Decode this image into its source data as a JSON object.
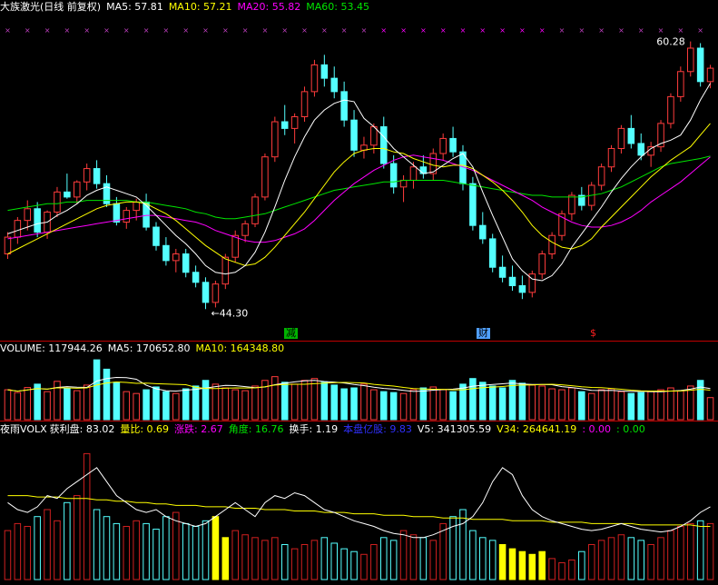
{
  "header_main": {
    "title": "大族激光(日线 前复权)",
    "ma5": "MA5: 57.81",
    "ma10": "MA10: 57.21",
    "ma20": "MA20: 55.82",
    "ma60": "MA60: 53.45"
  },
  "header_volume": {
    "volume": "VOLUME: 117944.26",
    "ma5": "MA5: 170652.80",
    "ma10": "MA10: 164348.80"
  },
  "header_indicator": {
    "name": "夜雨VOLX",
    "profit": "获利盘: 83.02",
    "ratio": "量比: 0.69",
    "change": "涨跌: 2.67",
    "angle": "角度: 16.76",
    "turnover": "换手: 1.19",
    "float": "本盘亿股: 9.83",
    "v5": "V5: 341305.59",
    "v34": "V34: 264641.19",
    "e1": ": 0.00",
    "e2": ": 0.00"
  },
  "markers": {
    "m1": "减",
    "m2": "财",
    "m3": "$"
  },
  "colors": {
    "up": "#ff3c3c",
    "down": "#54ffff",
    "ma5": "#ffffff",
    "ma10": "#ffff00",
    "ma20": "#ff00ff",
    "ma60": "#00e600",
    "volred": "#d02020",
    "highlight": "#ffff00",
    "separator": "#c00000"
  },
  "chart_data": {
    "type": "candlestick",
    "price_range": [
      43.5,
      61.8
    ],
    "high_label": "60.28",
    "low_label": "44.30",
    "ohlc": [
      [
        47.6,
        48.9,
        47.3,
        48.6
      ],
      [
        48.6,
        49.8,
        48.2,
        49.6
      ],
      [
        49.6,
        50.8,
        49.0,
        50.3
      ],
      [
        50.3,
        50.7,
        48.6,
        48.9
      ],
      [
        48.9,
        50.2,
        48.5,
        50.1
      ],
      [
        50.1,
        51.6,
        49.8,
        51.3
      ],
      [
        51.3,
        52.4,
        50.9,
        51.0
      ],
      [
        51.0,
        52.0,
        50.6,
        51.9
      ],
      [
        51.9,
        53.0,
        51.4,
        52.7
      ],
      [
        52.7,
        53.2,
        51.5,
        51.8
      ],
      [
        51.8,
        52.3,
        50.4,
        50.6
      ],
      [
        50.6,
        51.0,
        49.3,
        49.5
      ],
      [
        49.5,
        50.4,
        49.1,
        50.2
      ],
      [
        50.2,
        50.9,
        49.6,
        50.7
      ],
      [
        50.7,
        51.2,
        49.0,
        49.2
      ],
      [
        49.2,
        49.5,
        47.8,
        48.1
      ],
      [
        48.1,
        48.6,
        46.9,
        47.2
      ],
      [
        47.2,
        47.9,
        46.5,
        47.6
      ],
      [
        47.6,
        47.9,
        46.2,
        46.5
      ],
      [
        46.5,
        46.9,
        45.6,
        45.9
      ],
      [
        45.9,
        46.2,
        44.3,
        44.7
      ],
      [
        44.7,
        46.0,
        44.4,
        45.8
      ],
      [
        45.8,
        47.6,
        45.5,
        47.4
      ],
      [
        47.4,
        49.0,
        47.1,
        48.7
      ],
      [
        48.7,
        49.6,
        48.3,
        49.4
      ],
      [
        49.4,
        51.2,
        49.2,
        51.0
      ],
      [
        51.0,
        53.6,
        50.8,
        53.4
      ],
      [
        53.4,
        55.8,
        53.1,
        55.5
      ],
      [
        55.5,
        56.5,
        54.7,
        55.1
      ],
      [
        55.1,
        56.0,
        54.2,
        55.8
      ],
      [
        55.8,
        57.6,
        55.5,
        57.3
      ],
      [
        57.3,
        59.2,
        57.0,
        58.9
      ],
      [
        58.9,
        59.5,
        57.6,
        58.1
      ],
      [
        58.1,
        58.8,
        56.9,
        57.3
      ],
      [
        57.3,
        57.9,
        55.2,
        55.6
      ],
      [
        55.6,
        56.2,
        53.4,
        53.8
      ],
      [
        53.8,
        54.6,
        53.3,
        54.1
      ],
      [
        54.1,
        55.4,
        53.6,
        55.2
      ],
      [
        55.2,
        55.8,
        52.7,
        53.0
      ],
      [
        53.0,
        53.5,
        51.2,
        51.6
      ],
      [
        51.6,
        52.3,
        50.7,
        52.0
      ],
      [
        52.0,
        53.1,
        51.5,
        52.8
      ],
      [
        52.8,
        53.5,
        52.1,
        52.4
      ],
      [
        52.4,
        53.9,
        52.0,
        53.6
      ],
      [
        53.6,
        54.8,
        53.2,
        54.5
      ],
      [
        54.5,
        55.2,
        53.4,
        53.7
      ],
      [
        53.7,
        54.1,
        51.4,
        51.8
      ],
      [
        51.8,
        52.2,
        49.0,
        49.3
      ],
      [
        49.3,
        50.1,
        48.2,
        48.5
      ],
      [
        48.5,
        48.8,
        46.5,
        46.8
      ],
      [
        46.8,
        47.5,
        45.9,
        46.2
      ],
      [
        46.2,
        46.9,
        45.4,
        45.7
      ],
      [
        45.7,
        46.3,
        44.9,
        45.3
      ],
      [
        45.3,
        46.6,
        45.0,
        46.4
      ],
      [
        46.4,
        47.8,
        46.1,
        47.6
      ],
      [
        47.6,
        48.9,
        47.3,
        48.7
      ],
      [
        48.7,
        50.2,
        48.4,
        50.0
      ],
      [
        50.0,
        51.3,
        49.6,
        51.1
      ],
      [
        51.1,
        51.6,
        50.2,
        50.5
      ],
      [
        50.5,
        51.9,
        50.2,
        51.7
      ],
      [
        51.7,
        53.0,
        51.4,
        52.8
      ],
      [
        52.8,
        54.1,
        52.5,
        53.9
      ],
      [
        53.9,
        55.3,
        53.6,
        55.1
      ],
      [
        55.1,
        55.9,
        53.9,
        54.2
      ],
      [
        54.2,
        54.8,
        53.2,
        53.5
      ],
      [
        53.5,
        54.3,
        52.8,
        54.0
      ],
      [
        54.0,
        55.6,
        53.7,
        55.4
      ],
      [
        55.4,
        57.2,
        55.1,
        57.0
      ],
      [
        57.0,
        58.8,
        56.7,
        58.5
      ],
      [
        58.5,
        60.3,
        58.2,
        59.9
      ],
      [
        59.9,
        60.2,
        57.6,
        57.9
      ],
      [
        57.9,
        58.9,
        57.5,
        58.7
      ]
    ],
    "ma5": [
      48.8,
      49.0,
      49.2,
      49.4,
      49.5,
      49.9,
      50.2,
      50.6,
      51.1,
      51.4,
      51.6,
      51.4,
      51.2,
      51.0,
      50.5,
      49.9,
      49.3,
      48.7,
      48.2,
      47.6,
      46.9,
      46.5,
      46.4,
      46.5,
      46.9,
      47.7,
      48.9,
      50.4,
      52.0,
      53.4,
      54.6,
      55.6,
      56.2,
      56.6,
      56.8,
      56.7,
      55.7,
      55.2,
      54.6,
      53.9,
      53.4,
      52.9,
      52.4,
      52.5,
      52.9,
      53.3,
      53.6,
      52.8,
      51.3,
      49.9,
      48.6,
      47.3,
      46.6,
      46.1,
      46.0,
      46.3,
      47.0,
      48.0,
      48.8,
      49.6,
      50.4,
      51.3,
      52.1,
      52.8,
      53.4,
      53.9,
      54.2,
      54.4,
      54.7,
      55.6,
      56.8,
      57.8
    ],
    "ma10": [
      47.6,
      47.9,
      48.2,
      48.5,
      48.8,
      49.1,
      49.4,
      49.7,
      50.0,
      50.3,
      50.5,
      50.6,
      50.7,
      50.7,
      50.6,
      50.3,
      50.0,
      49.6,
      49.1,
      48.6,
      48.1,
      47.7,
      47.3,
      47.1,
      46.9,
      47.0,
      47.4,
      48.0,
      48.7,
      49.4,
      50.1,
      50.9,
      51.7,
      52.5,
      53.1,
      53.6,
      53.8,
      53.9,
      53.9,
      53.7,
      53.6,
      53.3,
      53.1,
      52.9,
      52.8,
      52.9,
      52.9,
      52.7,
      52.3,
      51.9,
      51.4,
      50.8,
      50.1,
      49.3,
      48.7,
      48.3,
      48.0,
      47.9,
      48.1,
      48.5,
      49.2,
      49.8,
      50.4,
      51.0,
      51.6,
      52.2,
      52.7,
      53.2,
      53.6,
      54.0,
      54.7,
      55.4
    ],
    "ma20": [
      48.5,
      48.6,
      48.7,
      48.8,
      48.9,
      49.0,
      49.1,
      49.2,
      49.3,
      49.4,
      49.5,
      49.6,
      49.7,
      49.8,
      49.9,
      49.9,
      49.8,
      49.7,
      49.6,
      49.5,
      49.3,
      49.0,
      48.8,
      48.6,
      48.4,
      48.3,
      48.3,
      48.4,
      48.6,
      48.8,
      49.1,
      49.6,
      50.2,
      50.8,
      51.3,
      51.8,
      52.2,
      52.6,
      52.9,
      53.2,
      53.4,
      53.5,
      53.4,
      53.3,
      53.2,
      53.0,
      52.8,
      52.6,
      52.3,
      52.0,
      51.7,
      51.4,
      51.1,
      50.8,
      50.4,
      50.1,
      49.8,
      49.5,
      49.3,
      49.2,
      49.2,
      49.3,
      49.5,
      49.8,
      50.2,
      50.7,
      51.1,
      51.5,
      51.9,
      52.4,
      52.9,
      53.4
    ],
    "ma60": [
      50.2,
      50.3,
      50.4,
      50.5,
      50.6,
      50.6,
      50.7,
      50.7,
      50.8,
      50.8,
      50.8,
      50.8,
      50.8,
      50.7,
      50.7,
      50.6,
      50.5,
      50.4,
      50.3,
      50.1,
      50.0,
      49.8,
      49.7,
      49.7,
      49.8,
      49.9,
      50.0,
      50.2,
      50.4,
      50.6,
      50.8,
      51.0,
      51.2,
      51.4,
      51.5,
      51.6,
      51.7,
      51.8,
      51.9,
      51.9,
      52.0,
      52.0,
      52.0,
      52.0,
      52.0,
      51.9,
      51.8,
      51.7,
      51.6,
      51.5,
      51.4,
      51.3,
      51.2,
      51.1,
      51.1,
      51.0,
      51.0,
      51.0,
      51.0,
      51.1,
      51.2,
      51.4,
      51.6,
      51.9,
      52.2,
      52.5,
      52.8,
      53.0,
      53.1,
      53.2,
      53.3,
      53.45
    ],
    "volume": [
      160000,
      145000,
      172000,
      190000,
      150000,
      205000,
      168000,
      155000,
      185000,
      320000,
      270000,
      200000,
      150000,
      140000,
      160000,
      175000,
      150000,
      140000,
      165000,
      180000,
      210000,
      190000,
      170000,
      160000,
      155000,
      180000,
      210000,
      230000,
      200000,
      190000,
      210000,
      220000,
      200000,
      185000,
      165000,
      170000,
      190000,
      160000,
      150000,
      145000,
      140000,
      160000,
      170000,
      175000,
      160000,
      150000,
      190000,
      220000,
      200000,
      180000,
      170000,
      210000,
      195000,
      185000,
      180000,
      165000,
      160000,
      170000,
      150000,
      140000,
      160000,
      165000,
      150000,
      140000,
      145000,
      150000,
      160000,
      170000,
      155000,
      180000,
      210000,
      117944
    ],
    "volume_range": [
      0,
      340000
    ],
    "volx_v5": [
      0.55,
      0.5,
      0.48,
      0.52,
      0.6,
      0.58,
      0.65,
      0.7,
      0.75,
      0.8,
      0.7,
      0.6,
      0.55,
      0.5,
      0.48,
      0.5,
      0.45,
      0.42,
      0.4,
      0.38,
      0.4,
      0.45,
      0.5,
      0.55,
      0.5,
      0.45,
      0.55,
      0.6,
      0.58,
      0.62,
      0.6,
      0.55,
      0.5,
      0.48,
      0.45,
      0.42,
      0.4,
      0.38,
      0.35,
      0.33,
      0.32,
      0.3,
      0.3,
      0.32,
      0.35,
      0.38,
      0.4,
      0.45,
      0.55,
      0.7,
      0.8,
      0.75,
      0.6,
      0.5,
      0.45,
      0.42,
      0.4,
      0.38,
      0.36,
      0.35,
      0.36,
      0.38,
      0.4,
      0.38,
      0.36,
      0.35,
      0.34,
      0.35,
      0.38,
      0.42,
      0.48,
      0.52
    ],
    "volx_v34": [
      0.6,
      0.6,
      0.6,
      0.59,
      0.59,
      0.59,
      0.58,
      0.58,
      0.58,
      0.57,
      0.57,
      0.56,
      0.56,
      0.55,
      0.55,
      0.54,
      0.54,
      0.53,
      0.53,
      0.53,
      0.52,
      0.52,
      0.52,
      0.51,
      0.51,
      0.51,
      0.5,
      0.5,
      0.5,
      0.49,
      0.49,
      0.49,
      0.48,
      0.48,
      0.48,
      0.47,
      0.47,
      0.47,
      0.46,
      0.46,
      0.46,
      0.45,
      0.45,
      0.45,
      0.44,
      0.44,
      0.44,
      0.43,
      0.43,
      0.43,
      0.43,
      0.42,
      0.42,
      0.42,
      0.42,
      0.41,
      0.41,
      0.41,
      0.41,
      0.4,
      0.4,
      0.4,
      0.4,
      0.4,
      0.39,
      0.39,
      0.39,
      0.39,
      0.39,
      0.39,
      0.38,
      0.38
    ],
    "volx_bars": [
      0.35,
      0.4,
      0.38,
      0.45,
      0.5,
      0.42,
      0.55,
      0.6,
      0.9,
      0.5,
      0.45,
      0.4,
      0.38,
      0.42,
      0.4,
      0.36,
      0.45,
      0.48,
      0.4,
      0.38,
      0.42,
      0.45,
      0.3,
      0.35,
      0.32,
      0.3,
      0.28,
      0.3,
      0.25,
      0.22,
      0.25,
      0.28,
      0.3,
      0.26,
      0.22,
      0.2,
      0.18,
      0.25,
      0.3,
      0.28,
      0.35,
      0.32,
      0.3,
      0.28,
      0.4,
      0.45,
      0.5,
      0.35,
      0.3,
      0.28,
      0.25,
      0.22,
      0.2,
      0.18,
      0.2,
      0.15,
      0.12,
      0.14,
      0.2,
      0.25,
      0.28,
      0.3,
      0.32,
      0.3,
      0.28,
      0.25,
      0.3,
      0.35,
      0.38,
      0.4,
      0.42,
      0.4
    ],
    "volx_highlight": [
      21,
      22,
      50,
      51,
      52,
      53,
      54
    ]
  }
}
